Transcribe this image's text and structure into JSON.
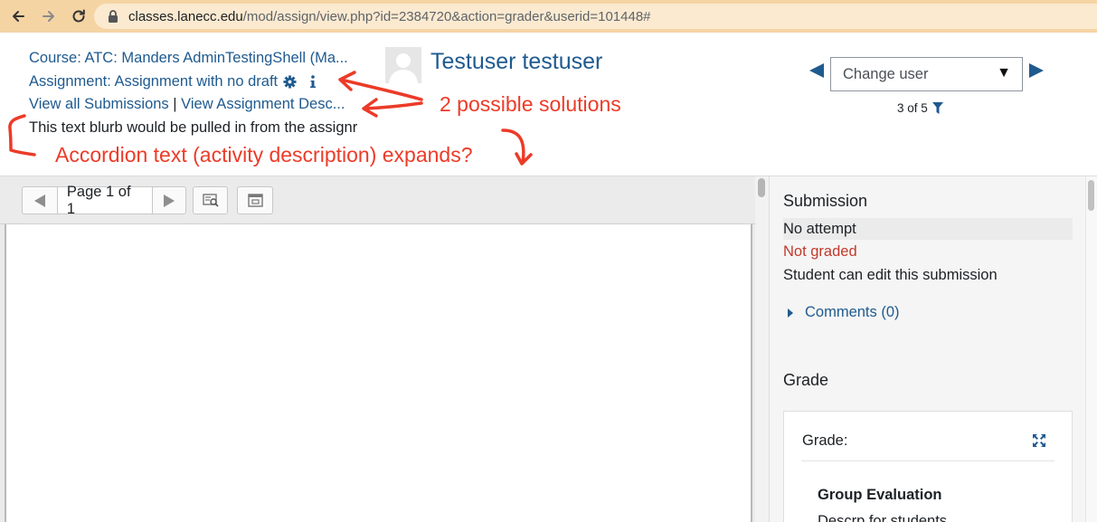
{
  "browser": {
    "url_host": "classes.lanecc.edu",
    "url_path": "/mod/assign/view.php?id=2384720&action=grader&userid=101448#"
  },
  "header": {
    "course_link": "Course: ATC: Manders AdminTestingShell (Ma...",
    "assignment_link": "Assignment: Assignment with no draft",
    "view_all_link": "View all Submissions",
    "separator": "|",
    "view_desc_link": "View Assignment Desc...",
    "blurb": "This text blurb would be pulled in from the assignr",
    "user_name": "Testuser testuser"
  },
  "user_nav": {
    "change_user_placeholder": "Change user",
    "counter": "3 of 5"
  },
  "annotations": {
    "solutions": "2 possible solutions",
    "accordion": "Accordion text (activity description) expands?"
  },
  "toolbar": {
    "page_label": "Page 1 of 1"
  },
  "submission": {
    "heading": "Submission",
    "attempt": "No attempt",
    "grading_status": "Not graded",
    "edit_status": "Student can edit this submission",
    "comments": "Comments (0)"
  },
  "grade": {
    "heading": "Grade",
    "label": "Grade:",
    "group_title": "Group Evaluation",
    "group_desc": "Descrp for students"
  },
  "colors": {
    "link": "#1f5a8f",
    "annotation": "#ec3b28",
    "not_graded": "#c0392b",
    "browser_bar": "#f5d4a4"
  }
}
